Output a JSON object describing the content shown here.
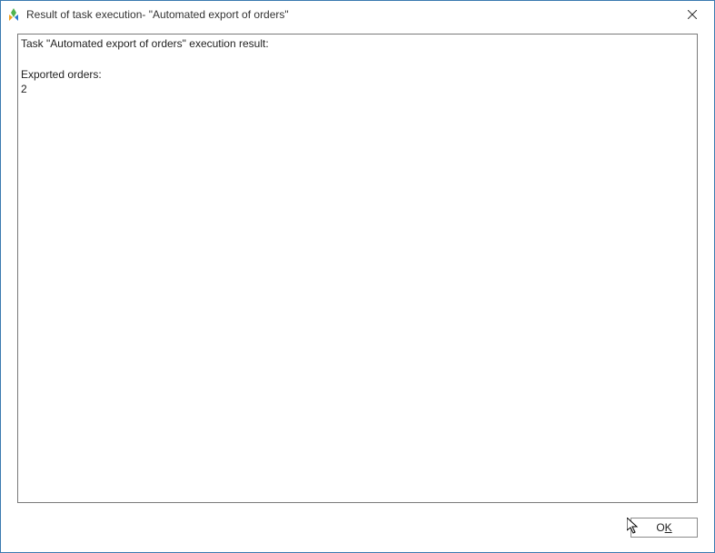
{
  "titlebar": {
    "title": "Result of task execution- \"Automated export of orders\""
  },
  "result": {
    "line1": "Task \"Automated export of orders\" execution result:",
    "blank": "",
    "line2": "Exported orders:",
    "line3": "2"
  },
  "buttons": {
    "ok_prefix": "O",
    "ok_suffix": "K"
  }
}
